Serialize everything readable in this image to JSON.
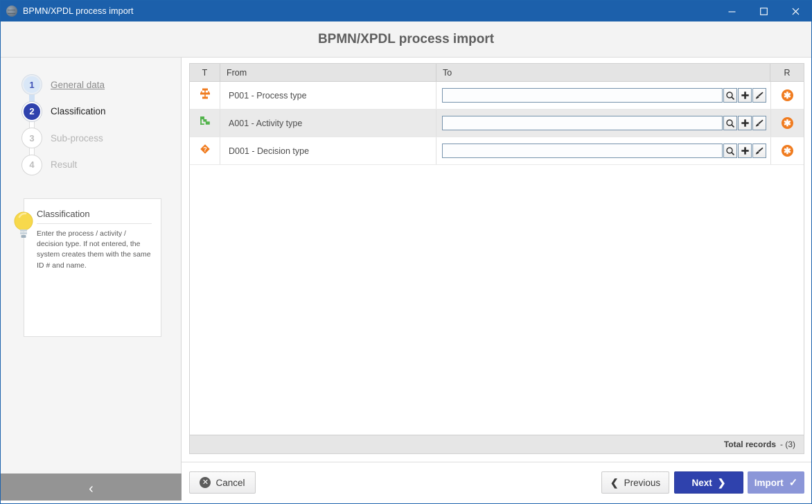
{
  "window": {
    "title": "BPMN/XPDL process import",
    "icon": "globe-icon",
    "minimize_label": "–",
    "maximize_label": "□",
    "close_label": "✕"
  },
  "header": {
    "title": "BPMN/XPDL process import"
  },
  "stepper": {
    "steps": [
      {
        "number": "1",
        "label": "General data",
        "state": "done"
      },
      {
        "number": "2",
        "label": "Classification",
        "state": "current"
      },
      {
        "number": "3",
        "label": "Sub-process",
        "state": "todo"
      },
      {
        "number": "4",
        "label": "Result",
        "state": "todo"
      }
    ]
  },
  "hint": {
    "icon": "lightbulb-icon",
    "title": "Classification",
    "text": "Enter the process / activity / decision type. If not entered, the system creates them with the same ID # and name."
  },
  "rail": {
    "collapse_label": "‹"
  },
  "grid": {
    "columns": [
      {
        "key": "t",
        "label": "T"
      },
      {
        "key": "from",
        "label": "From"
      },
      {
        "key": "to",
        "label": "To"
      },
      {
        "key": "r",
        "label": "R"
      }
    ],
    "rows": [
      {
        "type_icon": "process-type-icon",
        "from": "P001 - Process type",
        "to_value": "",
        "to_placeholder": "",
        "actions": [
          "search-icon",
          "plus-icon",
          "brush-icon"
        ],
        "remove_icon": "remove-icon"
      },
      {
        "type_icon": "activity-type-icon",
        "from": "A001 - Activity type",
        "to_value": "",
        "to_placeholder": "",
        "actions": [
          "search-icon",
          "plus-icon",
          "brush-icon"
        ],
        "remove_icon": "remove-icon"
      },
      {
        "type_icon": "decision-type-icon",
        "from": "D001 - Decision type",
        "to_value": "",
        "to_placeholder": "",
        "actions": [
          "search-icon",
          "plus-icon",
          "brush-icon"
        ],
        "remove_icon": "remove-icon"
      }
    ],
    "footer": {
      "total_label": "Total records",
      "total_value": "- (3)"
    }
  },
  "footer": {
    "cancel_label": "Cancel",
    "previous_label": "Previous",
    "next_label": "Next",
    "import_label": "Import",
    "prev_chevron": "❮",
    "next_chevron": "❯",
    "import_check": "✓"
  },
  "colors": {
    "titlebar": "#1c60ab",
    "accent_blue": "#2f42ad",
    "accent_blue_light": "#8b96d8",
    "orange": "#f07c20",
    "green": "#52b34b",
    "rail_collapse": "#949494"
  }
}
